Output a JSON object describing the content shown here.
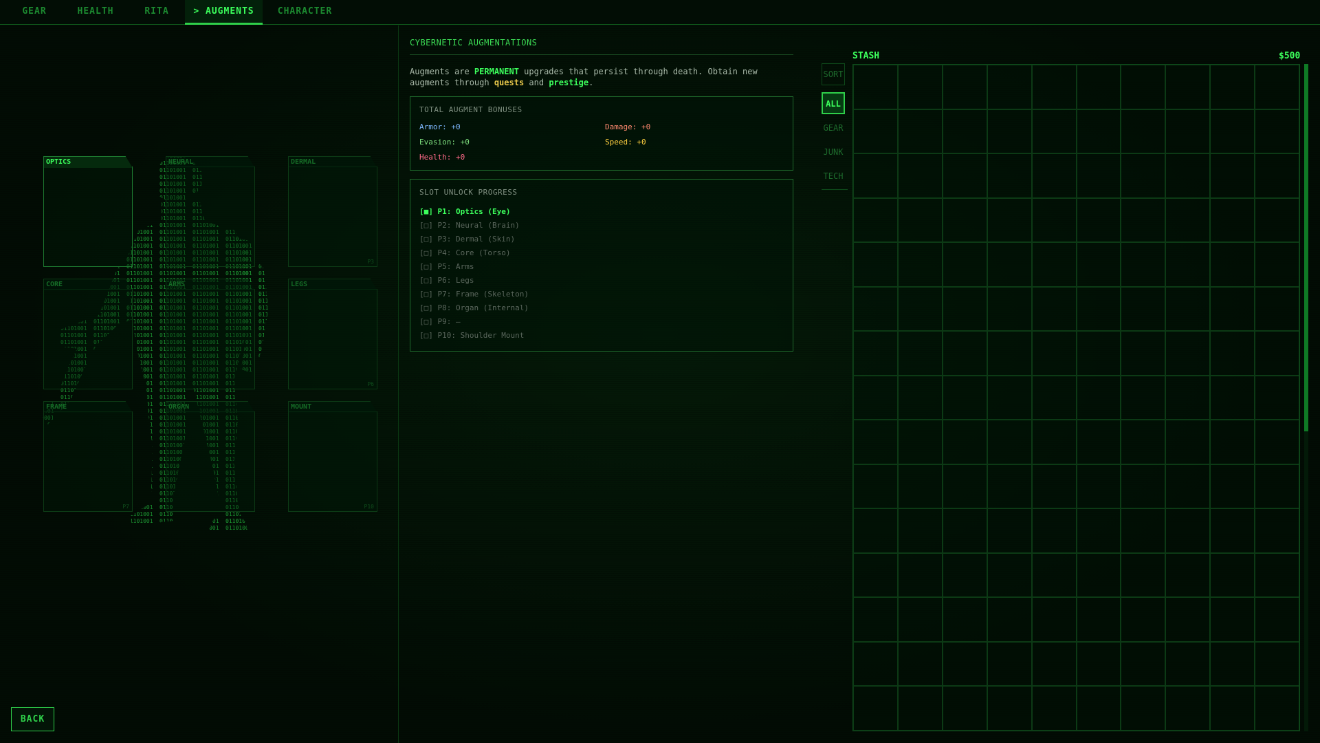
{
  "tabs": [
    {
      "label": "GEAR",
      "active": false
    },
    {
      "label": "HEALTH",
      "active": false
    },
    {
      "label": "RITA",
      "active": false
    },
    {
      "label": "> AUGMENTS",
      "active": true
    },
    {
      "label": "CHARACTER",
      "active": false
    }
  ],
  "slots": [
    {
      "label": "OPTICS",
      "tag": "",
      "active": true
    },
    {
      "label": "NEURAL",
      "tag": "",
      "active": false
    },
    {
      "label": "DERMAL",
      "tag": "P3",
      "active": false
    },
    {
      "label": "CORE",
      "tag": "",
      "active": false
    },
    {
      "label": "ARMS",
      "tag": "",
      "active": false
    },
    {
      "label": "LEGS",
      "tag": "P6",
      "active": false
    },
    {
      "label": "FRAME",
      "tag": "P7",
      "active": false
    },
    {
      "label": "ORGAN",
      "tag": "",
      "active": false
    },
    {
      "label": "MOUNT",
      "tag": "P10",
      "active": false
    }
  ],
  "back_label": "BACK",
  "augments": {
    "title": "CYBERNETIC AUGMENTATIONS",
    "intro": {
      "part1": "Augments are ",
      "permanent": "PERMANENT",
      "part2": " upgrades that persist through death. Obtain new augments through ",
      "quests": "quests",
      "and": " and ",
      "prestige": "prestige",
      "end": "."
    },
    "bonuses": {
      "title": "TOTAL AUGMENT BONUSES",
      "armor": "Armor: +0",
      "damage": "Damage: +0",
      "evasion": "Evasion: +0",
      "speed": "Speed: +0",
      "health": "Health: +0"
    },
    "unlock": {
      "title": "SLOT UNLOCK PROGRESS",
      "items": [
        "[■] P1: Optics (Eye)",
        "[□] P2: Neural (Brain)",
        "[□] P3: Dermal (Skin)",
        "[□] P4: Core (Torso)",
        "[□] P5: Arms",
        "[□] P6: Legs",
        "[□] P7: Frame (Skeleton)",
        "[□] P8: Organ (Internal)",
        "[□] P9: —",
        "[□] P10: Shoulder Mount"
      ]
    }
  },
  "stash": {
    "title": "STASH",
    "money": "$500",
    "columns": 10,
    "rows": 15,
    "scroll_fraction": 0.55
  },
  "filters": [
    "SORT",
    "ALL",
    "GEAR",
    "JUNK",
    "TECH"
  ],
  "colors": {
    "accent": "#3cff5c",
    "armor": "#7fb8ff",
    "damage": "#ff8a70",
    "evasion": "#7fe07f",
    "speed": "#ffd040",
    "health": "#ff6a8a",
    "quests": "#e8c84a"
  }
}
